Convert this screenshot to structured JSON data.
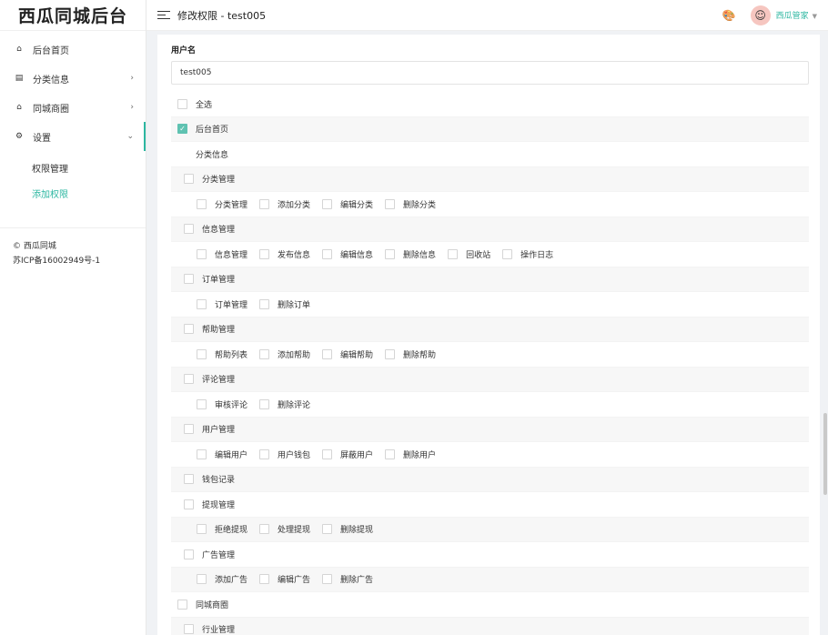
{
  "app": {
    "logo": "西瓜同城后台"
  },
  "sidebar": {
    "items": [
      {
        "icon": "home-icon",
        "glyph": "⌂",
        "label": "后台首页",
        "chevron": ""
      },
      {
        "icon": "list-icon",
        "glyph": "▤",
        "label": "分类信息",
        "chevron": "›"
      },
      {
        "icon": "store-icon",
        "glyph": "⌂",
        "label": "同城商圈",
        "chevron": "›"
      },
      {
        "icon": "gear-icon",
        "glyph": "⚙",
        "label": "设置",
        "chevron": "⌄"
      }
    ],
    "subitems": [
      {
        "label": "权限管理"
      },
      {
        "label": "添加权限"
      }
    ],
    "footer": {
      "line1": "© 西瓜同城",
      "line2": "苏ICP备16002949号-1"
    }
  },
  "header": {
    "title": "修改权限 - test005",
    "user": "西瓜管家",
    "accent": "#2db7a1"
  },
  "form": {
    "username_label": "用户名",
    "username_value": "test005"
  },
  "perms": {
    "select_all": "全选",
    "home": "后台首页",
    "classify": "分类信息",
    "g1": {
      "title": "分类管理",
      "items": [
        "分类管理",
        "添加分类",
        "编辑分类",
        "删除分类"
      ]
    },
    "g2": {
      "title": "信息管理",
      "items": [
        "信息管理",
        "发布信息",
        "编辑信息",
        "删除信息",
        "回收站",
        "操作日志"
      ]
    },
    "g3": {
      "title": "订单管理",
      "items": [
        "订单管理",
        "删除订单"
      ]
    },
    "g4": {
      "title": "帮助管理",
      "items": [
        "帮助列表",
        "添加帮助",
        "编辑帮助",
        "删除帮助"
      ]
    },
    "g5": {
      "title": "评论管理",
      "items": [
        "审核评论",
        "删除评论"
      ]
    },
    "g6": {
      "title": "用户管理",
      "items": [
        "编辑用户",
        "用户钱包",
        "屏蔽用户",
        "删除用户"
      ]
    },
    "g7": {
      "title": "钱包记录"
    },
    "g8": {
      "title": "提现管理",
      "items": [
        "拒绝提现",
        "处理提现",
        "删除提现"
      ]
    },
    "g9": {
      "title": "广告管理",
      "items": [
        "添加广告",
        "编辑广告",
        "删除广告"
      ]
    },
    "shop": "同城商圈",
    "g10": {
      "title": "行业管理"
    }
  }
}
